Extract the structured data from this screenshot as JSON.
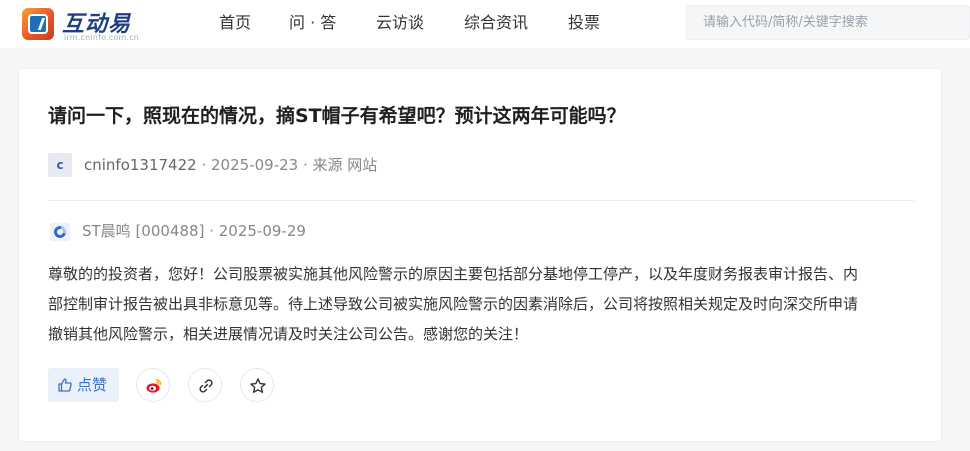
{
  "header": {
    "logo_title": "互动易",
    "logo_subtitle": "irm.cninfo.com.cn",
    "nav": [
      "首页",
      "问 · 答",
      "云访谈",
      "综合资讯",
      "投票"
    ],
    "search_placeholder": "请输入代码/简称/关键字搜索"
  },
  "question": {
    "title": "请问一下，照现在的情况，摘ST帽子有希望吧？预计这两年可能吗？",
    "avatar_letter": "c",
    "asker": "cninfo1317422",
    "date": "2025-09-23",
    "source": "来源 网站"
  },
  "reply": {
    "company": "ST晨鸣 [000488]",
    "date": "2025-09-29",
    "lines": [
      "尊敬的的投资者，您好！公司股票被实施其他风险警示的原因主要包括部分基地停工停产，以及年度财务报表审计报告、内",
      "部控制审计报告被出具非标意见等。待上述导致公司被实施风险警示的因素消除后，公司将按照相关规定及时向深交所申请",
      "撤销其他风险警示，相关进展情况请及时关注公司公告。感谢您的关注！"
    ]
  },
  "actions": {
    "like_label": "点赞",
    "icons": [
      "thumbs-up-icon",
      "weibo-icon",
      "link-icon",
      "star-icon"
    ]
  },
  "colors": {
    "accent": "#3a72c4",
    "title": "#1f1f1f",
    "muted": "#888888",
    "weibo": "#e6162d"
  }
}
